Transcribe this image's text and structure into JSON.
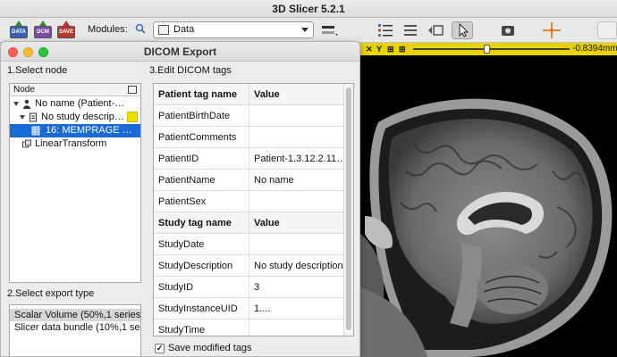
{
  "app": {
    "title": "3D Slicer 5.2.1"
  },
  "toolbar": {
    "data_label": "DATA",
    "dcm_label": "DCM",
    "save_label": "SAVE",
    "modules_label": "Modules:",
    "module_selected": "Data"
  },
  "slice": {
    "y_label": "Y",
    "offset_value": "-0.8394mm",
    "slider_fraction": 0.47,
    "bar_color": "#e8d200"
  },
  "dialog": {
    "title": "DICOM Export",
    "select_node_label": "1.Select node",
    "edit_tags_label": "3.Edit DICOM tags",
    "select_export_label": "2.Select export type",
    "tree_header": "Node",
    "tree_items": [
      {
        "label": "No name (Patient-…",
        "level": 0,
        "icon": "patient-icon",
        "selected": false
      },
      {
        "label": "No study descrip…",
        "level": 1,
        "icon": "study-icon",
        "selected": false
      },
      {
        "label": "16: MEMPRAGE …",
        "level": 2,
        "icon": "volume-icon",
        "selected": true
      },
      {
        "label": "LinearTransform",
        "level": 0,
        "icon": "transform-icon",
        "selected": false
      }
    ],
    "export_types": [
      {
        "label": "Scalar Volume (50%,1 series)",
        "selected": true
      },
      {
        "label": "Slicer data bundle (10%,1 seri",
        "selected": false
      }
    ],
    "patient_header": {
      "name": "Patient tag name",
      "value": "Value"
    },
    "patient_tags": [
      {
        "name": "PatientBirthDate",
        "value": ""
      },
      {
        "name": "PatientComments",
        "value": ""
      },
      {
        "name": "PatientID",
        "value": "Patient-1.3.12.2.11…"
      },
      {
        "name": "PatientName",
        "value": "No name"
      },
      {
        "name": "PatientSex",
        "value": ""
      }
    ],
    "study_header": {
      "name": "Study tag name",
      "value": "Value"
    },
    "study_tags": [
      {
        "name": "StudyDate",
        "value": ""
      },
      {
        "name": "StudyDescription",
        "value": "No study description"
      },
      {
        "name": "StudyID",
        "value": "3"
      },
      {
        "name": "StudyInstanceUID",
        "value": "1...."
      },
      {
        "name": "StudyTime",
        "value": ""
      }
    ],
    "save_modified_label": "Save modified tags",
    "save_modified_checked": true
  },
  "colors": {
    "selection": "#1a6ad6",
    "close_light": "#fe5f57",
    "min_light": "#febc2e",
    "max_light": "#28c840"
  }
}
